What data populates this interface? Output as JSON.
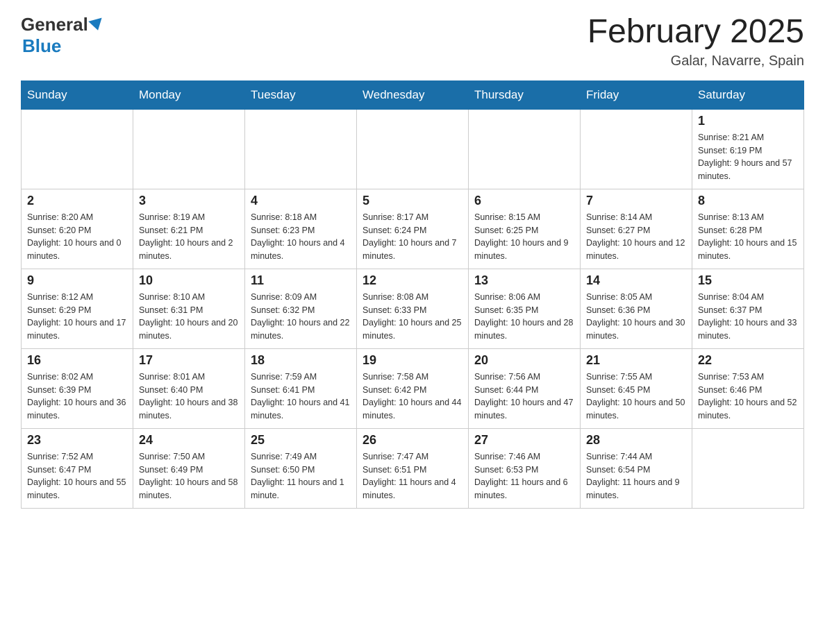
{
  "logo": {
    "general": "General",
    "blue": "Blue"
  },
  "header": {
    "title": "February 2025",
    "subtitle": "Galar, Navarre, Spain"
  },
  "days_of_week": [
    "Sunday",
    "Monday",
    "Tuesday",
    "Wednesday",
    "Thursday",
    "Friday",
    "Saturday"
  ],
  "weeks": [
    [
      null,
      null,
      null,
      null,
      null,
      null,
      {
        "day": 1,
        "sunrise": "8:21 AM",
        "sunset": "6:19 PM",
        "daylight": "9 hours and 57 minutes"
      }
    ],
    [
      {
        "day": 2,
        "sunrise": "8:20 AM",
        "sunset": "6:20 PM",
        "daylight": "10 hours and 0 minutes"
      },
      {
        "day": 3,
        "sunrise": "8:19 AM",
        "sunset": "6:21 PM",
        "daylight": "10 hours and 2 minutes"
      },
      {
        "day": 4,
        "sunrise": "8:18 AM",
        "sunset": "6:23 PM",
        "daylight": "10 hours and 4 minutes"
      },
      {
        "day": 5,
        "sunrise": "8:17 AM",
        "sunset": "6:24 PM",
        "daylight": "10 hours and 7 minutes"
      },
      {
        "day": 6,
        "sunrise": "8:15 AM",
        "sunset": "6:25 PM",
        "daylight": "10 hours and 9 minutes"
      },
      {
        "day": 7,
        "sunrise": "8:14 AM",
        "sunset": "6:27 PM",
        "daylight": "10 hours and 12 minutes"
      },
      {
        "day": 8,
        "sunrise": "8:13 AM",
        "sunset": "6:28 PM",
        "daylight": "10 hours and 15 minutes"
      }
    ],
    [
      {
        "day": 9,
        "sunrise": "8:12 AM",
        "sunset": "6:29 PM",
        "daylight": "10 hours and 17 minutes"
      },
      {
        "day": 10,
        "sunrise": "8:10 AM",
        "sunset": "6:31 PM",
        "daylight": "10 hours and 20 minutes"
      },
      {
        "day": 11,
        "sunrise": "8:09 AM",
        "sunset": "6:32 PM",
        "daylight": "10 hours and 22 minutes"
      },
      {
        "day": 12,
        "sunrise": "8:08 AM",
        "sunset": "6:33 PM",
        "daylight": "10 hours and 25 minutes"
      },
      {
        "day": 13,
        "sunrise": "8:06 AM",
        "sunset": "6:35 PM",
        "daylight": "10 hours and 28 minutes"
      },
      {
        "day": 14,
        "sunrise": "8:05 AM",
        "sunset": "6:36 PM",
        "daylight": "10 hours and 30 minutes"
      },
      {
        "day": 15,
        "sunrise": "8:04 AM",
        "sunset": "6:37 PM",
        "daylight": "10 hours and 33 minutes"
      }
    ],
    [
      {
        "day": 16,
        "sunrise": "8:02 AM",
        "sunset": "6:39 PM",
        "daylight": "10 hours and 36 minutes"
      },
      {
        "day": 17,
        "sunrise": "8:01 AM",
        "sunset": "6:40 PM",
        "daylight": "10 hours and 38 minutes"
      },
      {
        "day": 18,
        "sunrise": "7:59 AM",
        "sunset": "6:41 PM",
        "daylight": "10 hours and 41 minutes"
      },
      {
        "day": 19,
        "sunrise": "7:58 AM",
        "sunset": "6:42 PM",
        "daylight": "10 hours and 44 minutes"
      },
      {
        "day": 20,
        "sunrise": "7:56 AM",
        "sunset": "6:44 PM",
        "daylight": "10 hours and 47 minutes"
      },
      {
        "day": 21,
        "sunrise": "7:55 AM",
        "sunset": "6:45 PM",
        "daylight": "10 hours and 50 minutes"
      },
      {
        "day": 22,
        "sunrise": "7:53 AM",
        "sunset": "6:46 PM",
        "daylight": "10 hours and 52 minutes"
      }
    ],
    [
      {
        "day": 23,
        "sunrise": "7:52 AM",
        "sunset": "6:47 PM",
        "daylight": "10 hours and 55 minutes"
      },
      {
        "day": 24,
        "sunrise": "7:50 AM",
        "sunset": "6:49 PM",
        "daylight": "10 hours and 58 minutes"
      },
      {
        "day": 25,
        "sunrise": "7:49 AM",
        "sunset": "6:50 PM",
        "daylight": "11 hours and 1 minute"
      },
      {
        "day": 26,
        "sunrise": "7:47 AM",
        "sunset": "6:51 PM",
        "daylight": "11 hours and 4 minutes"
      },
      {
        "day": 27,
        "sunrise": "7:46 AM",
        "sunset": "6:53 PM",
        "daylight": "11 hours and 6 minutes"
      },
      {
        "day": 28,
        "sunrise": "7:44 AM",
        "sunset": "6:54 PM",
        "daylight": "11 hours and 9 minutes"
      },
      null
    ]
  ]
}
